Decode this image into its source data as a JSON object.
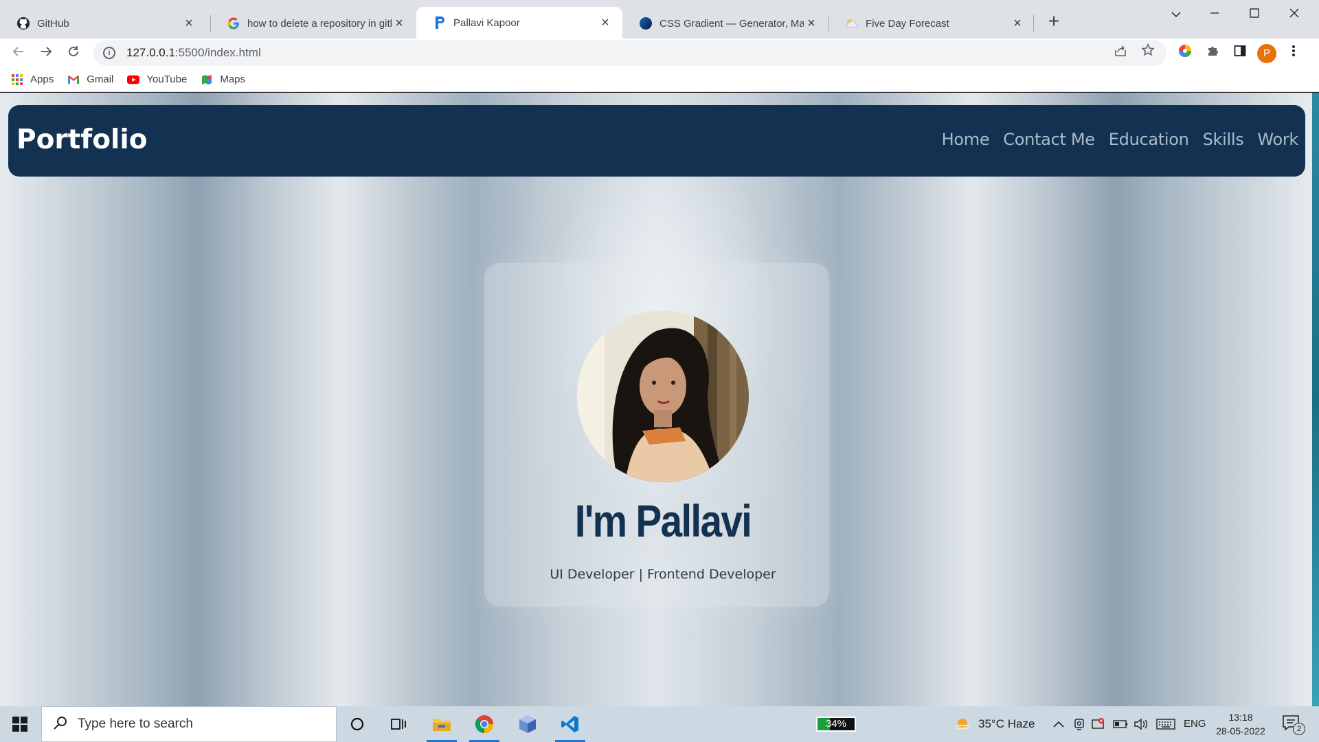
{
  "browser": {
    "tabs": [
      {
        "title": "GitHub",
        "icon": "github-icon"
      },
      {
        "title": "how to delete a repository in gith",
        "icon": "google-icon"
      },
      {
        "title": "Pallavi Kapoor",
        "icon": "p-logo-icon",
        "active": true
      },
      {
        "title": "CSS Gradient — Generator, Make",
        "icon": "cssgradient-icon"
      },
      {
        "title": "Five Day Forecast",
        "icon": "weather-icon"
      }
    ],
    "url_host": "127.0.0.1",
    "url_rest": ":5500/index.html",
    "bookmarks": [
      "Apps",
      "Gmail",
      "YouTube",
      "Maps"
    ],
    "profile_initial": "P"
  },
  "site": {
    "logo": "Portfolio",
    "nav": [
      "Home",
      "Contact Me",
      "Education",
      "Skills",
      "Work"
    ],
    "hero_name": "I'm Pallavi",
    "hero_subtitle": "UI Developer | Frontend Developer",
    "colors": {
      "nav_bg": "#133150",
      "accent": "#133150"
    }
  },
  "taskbar": {
    "search_placeholder": "Type here to search",
    "battery_percent": 34,
    "battery_label": "34%",
    "weather": "35°C  Haze",
    "language": "ENG",
    "time": "13:18",
    "date": "28-05-2022",
    "notification_count": "2"
  }
}
